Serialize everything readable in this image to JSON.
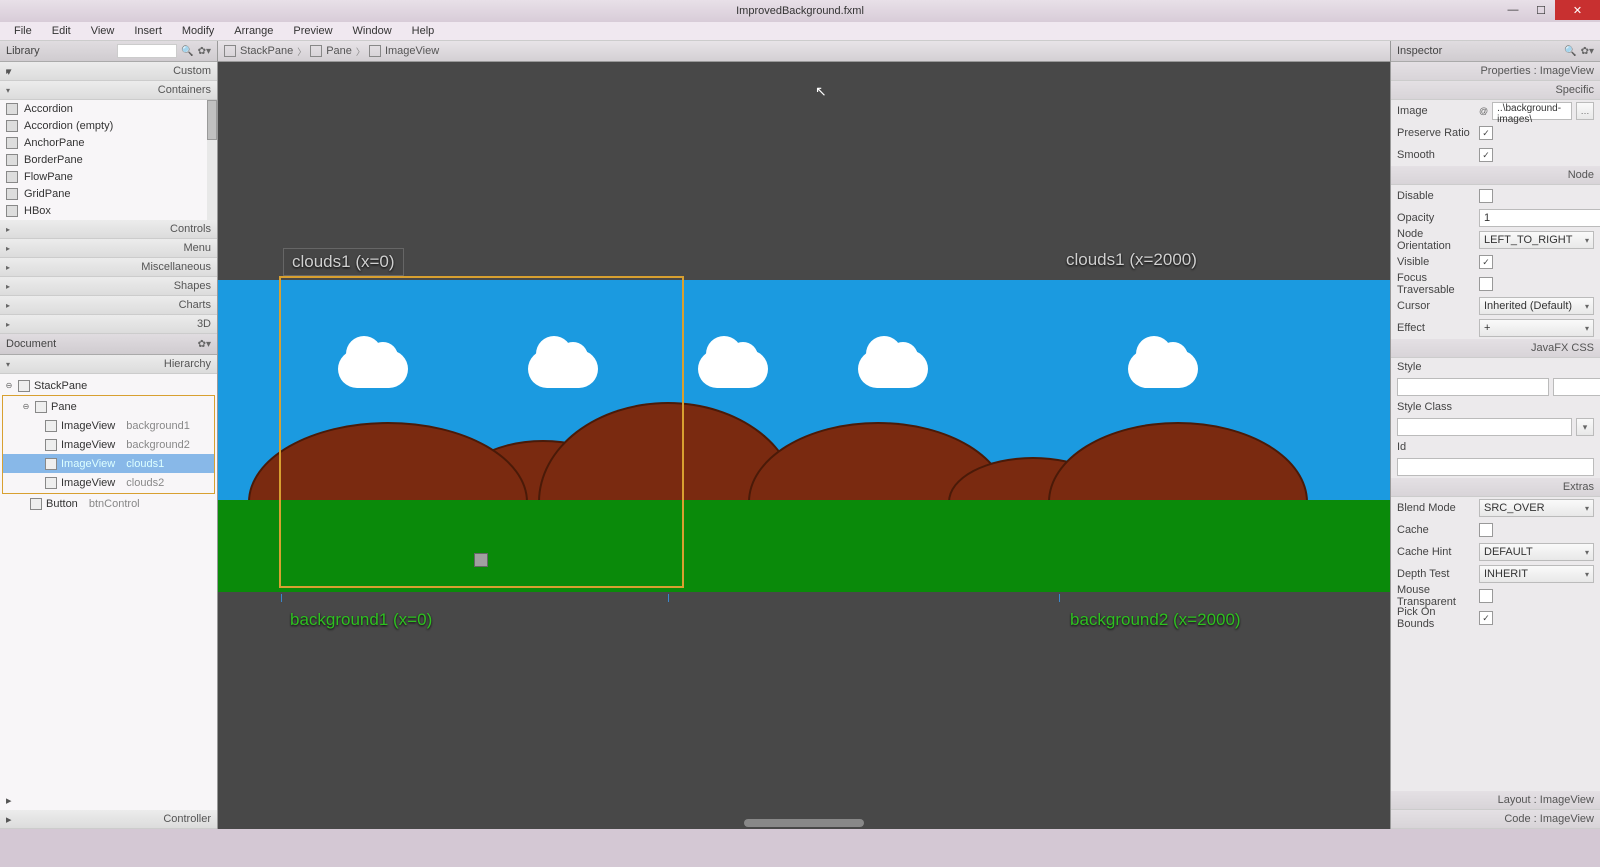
{
  "title": "ImprovedBackground.fxml",
  "menu": [
    "File",
    "Edit",
    "View",
    "Insert",
    "Modify",
    "Arrange",
    "Preview",
    "Window",
    "Help"
  ],
  "library": {
    "header": "Library",
    "categories": [
      "Custom",
      "Containers",
      "Controls",
      "Menu",
      "Miscellaneous",
      "Shapes",
      "Charts",
      "3D"
    ],
    "container_items": [
      "Accordion",
      "Accordion  (empty)",
      "AnchorPane",
      "BorderPane",
      "FlowPane",
      "GridPane",
      "HBox"
    ]
  },
  "document": {
    "header": "Document",
    "sub": "Hierarchy",
    "tree": [
      {
        "type": "StackPane",
        "id": "",
        "depth": 0,
        "icon": "stack"
      },
      {
        "type": "Pane",
        "id": "",
        "depth": 1,
        "icon": "pane"
      },
      {
        "type": "ImageView",
        "id": "background1",
        "depth": 2,
        "icon": "img"
      },
      {
        "type": "ImageView",
        "id": "background2",
        "depth": 2,
        "icon": "img"
      },
      {
        "type": "ImageView",
        "id": "clouds1",
        "depth": 2,
        "icon": "img",
        "sel": true
      },
      {
        "type": "ImageView",
        "id": "clouds2",
        "depth": 2,
        "icon": "img"
      },
      {
        "type": "Button",
        "id": "btnControl",
        "depth": 1,
        "icon": "btn"
      }
    ],
    "footer": "Controller"
  },
  "breadcrumb": [
    "StackPane",
    "Pane",
    "ImageView"
  ],
  "canvas_labels": {
    "c1": "clouds1 (x=0)",
    "c2": "clouds1 (x=2000)",
    "b1": "background1 (x=0)",
    "b2": "background2 (x=2000)"
  },
  "inspector": {
    "header": "Inspector",
    "prop_header": "Properties : ImageView",
    "sections": {
      "specific": "Specific",
      "node": "Node",
      "css": "JavaFX CSS",
      "extras": "Extras"
    },
    "props": {
      "image_lbl": "Image",
      "image_val": "..\\background-images\\",
      "preserve_lbl": "Preserve Ratio",
      "preserve_val": true,
      "smooth_lbl": "Smooth",
      "smooth_val": true,
      "disable_lbl": "Disable",
      "disable_val": false,
      "opacity_lbl": "Opacity",
      "opacity_val": "1",
      "orient_lbl": "Node Orientation",
      "orient_val": "LEFT_TO_RIGHT",
      "visible_lbl": "Visible",
      "visible_val": true,
      "focus_lbl": "Focus Traversable",
      "focus_val": false,
      "cursor_lbl": "Cursor",
      "cursor_val": "Inherited (Default)",
      "effect_lbl": "Effect",
      "effect_val": "+",
      "style_lbl": "Style",
      "style_val": "",
      "styleclass_lbl": "Style Class",
      "styleclass_val": "",
      "id_lbl": "Id",
      "id_val": "",
      "blend_lbl": "Blend Mode",
      "blend_val": "SRC_OVER",
      "cache_lbl": "Cache",
      "cache_val": false,
      "hint_lbl": "Cache Hint",
      "hint_val": "DEFAULT",
      "depth_lbl": "Depth Test",
      "depth_val": "INHERIT",
      "mouse_lbl": "Mouse Transparent",
      "mouse_val": false,
      "pick_lbl": "Pick On Bounds",
      "pick_val": true
    },
    "layout_footer": "Layout : ImageView",
    "code_footer": "Code : ImageView"
  }
}
